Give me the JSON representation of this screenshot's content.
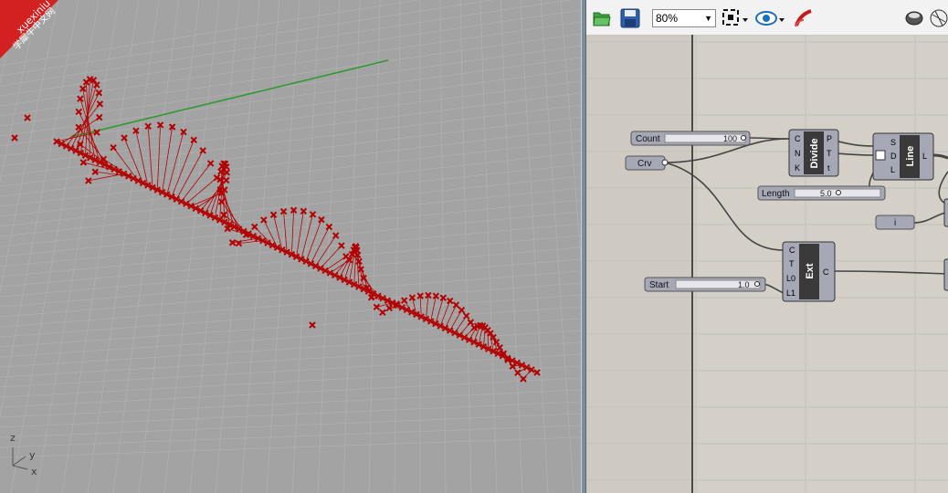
{
  "watermark": {
    "line1": "xuexiniu",
    "line2": "学犀牛中文网",
    "color": "#d32020"
  },
  "viewport": {
    "axis_labels": {
      "z": "z",
      "y": "y",
      "x": "x"
    },
    "colors": {
      "background": "#a3a3a3",
      "grid": "#b4b4b4",
      "points": "#b30000",
      "green_axis": "#2f9a2f"
    }
  },
  "toolbar": {
    "zoom_value": "80%",
    "icons": [
      "open-file-icon",
      "save-icon",
      "zoom-dropdown",
      "zoom-extents-icon",
      "preview-eye-icon",
      "sketch-brush-icon",
      "shaded-preview-icon",
      "wire-preview-icon"
    ]
  },
  "canvas": {
    "colors": {
      "background": "#d4d0c8",
      "gridline": "#c2bfb8",
      "component": "#a6a8b6",
      "component_dark": "#3a3a3a",
      "wire": "#444444"
    },
    "count_slider": {
      "label": "Count",
      "value": "100"
    },
    "crv_param": {
      "label": "Crv"
    },
    "length_slider": {
      "label": "Length",
      "value": "5.0"
    },
    "start_slider": {
      "label": "Start",
      "value": "1.0"
    },
    "i_param": {
      "label": "i"
    },
    "divide": {
      "name": "Divide",
      "inputs": [
        "C",
        "N",
        "K"
      ],
      "outputs": [
        "P",
        "T",
        "t"
      ]
    },
    "line": {
      "name": "Line",
      "inputs": [
        "S",
        "D",
        "L"
      ],
      "outputs": [
        "L"
      ]
    },
    "ext": {
      "name": "Ext",
      "inputs": [
        "C",
        "T",
        "L0",
        "L1"
      ],
      "outputs": [
        "C"
      ]
    }
  }
}
